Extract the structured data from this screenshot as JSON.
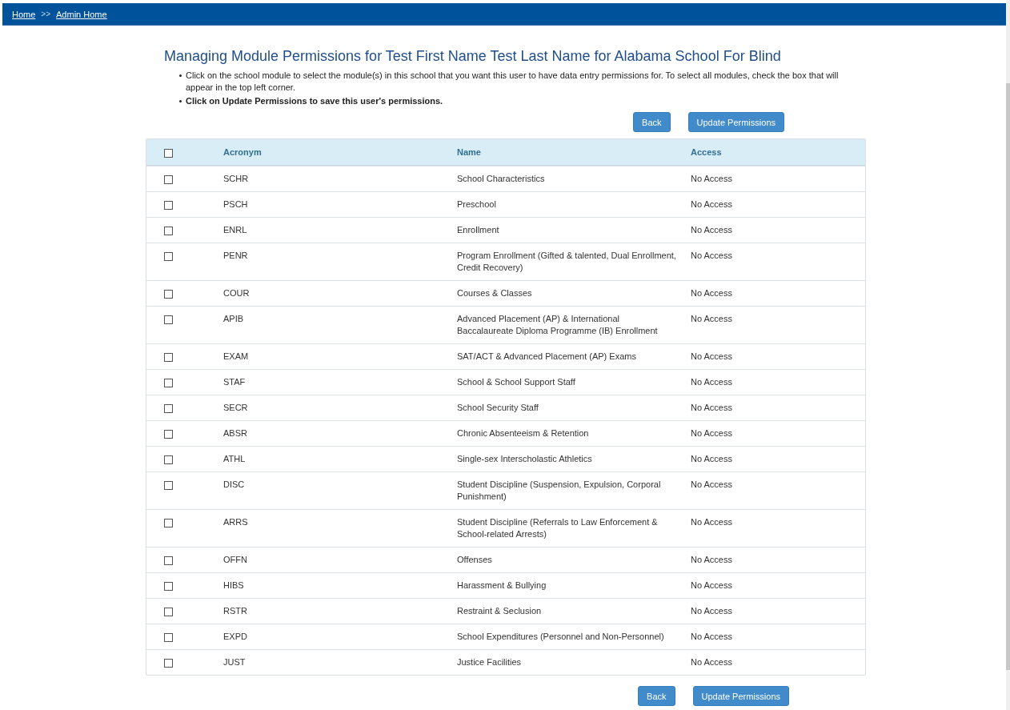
{
  "breadcrumbs": [
    {
      "label": "Home"
    },
    {
      "label": "Admin Home"
    }
  ],
  "breadcrumb_separator": ">>",
  "title": "Managing Module Permissions for Test First Name Test Last Name for Alabama School For Blind",
  "instructions": [
    {
      "text": "Click on the school module to select the module(s) in this school that you want this user to have data entry permissions for. To select all modules, check the box that will appear in the top left corner.",
      "bold": false
    },
    {
      "text": "Click on Update Permissions to save this user's permissions.",
      "bold": true
    }
  ],
  "top_buttons": [
    "Back",
    "Update Permissions"
  ],
  "table": {
    "select_all_checked": false,
    "columns": [
      "Acronym",
      "Name",
      "Access"
    ],
    "rows": [
      {
        "acronym": "SCHR",
        "name": "School Characteristics",
        "access": "No Access",
        "checked": false
      },
      {
        "acronym": "PSCH",
        "name": "Preschool",
        "access": "No Access",
        "checked": false
      },
      {
        "acronym": "ENRL",
        "name": "Enrollment",
        "access": "No Access",
        "checked": false
      },
      {
        "acronym": "PENR",
        "name": "Program Enrollment (Gifted & talented, Dual Enrollment, Credit Recovery)",
        "access": "No Access",
        "checked": false
      },
      {
        "acronym": "COUR",
        "name": "Courses & Classes",
        "access": "No Access",
        "checked": false
      },
      {
        "acronym": "APIB",
        "name": "Advanced Placement (AP) & International Baccalaureate Diploma Programme (IB) Enrollment",
        "access": "No Access",
        "checked": false
      },
      {
        "acronym": "EXAM",
        "name": "SAT/ACT & Advanced Placement (AP) Exams",
        "access": "No Access",
        "checked": false
      },
      {
        "acronym": "STAF",
        "name": "School & School Support Staff",
        "access": "No Access",
        "checked": false
      },
      {
        "acronym": "SECR",
        "name": "School Security Staff",
        "access": "No Access",
        "checked": false
      },
      {
        "acronym": "ABSR",
        "name": "Chronic Absenteeism & Retention",
        "access": "No Access",
        "checked": false
      },
      {
        "acronym": "ATHL",
        "name": "Single-sex Interscholastic Athletics",
        "access": "No Access",
        "checked": false
      },
      {
        "acronym": "DISC",
        "name": "Student Discipline (Suspension, Expulsion, Corporal Punishment)",
        "access": "No Access",
        "checked": false
      },
      {
        "acronym": "ARRS",
        "name": "Student Discipline (Referrals to Law Enforcement & School-related Arrests)",
        "access": "No Access",
        "checked": false
      },
      {
        "acronym": "OFFN",
        "name": "Offenses",
        "access": "No Access",
        "checked": false
      },
      {
        "acronym": "HIBS",
        "name": "Harassment & Bullying",
        "access": "No Access",
        "checked": false
      },
      {
        "acronym": "RSTR",
        "name": "Restraint & Seclusion",
        "access": "No Access",
        "checked": false
      },
      {
        "acronym": "EXPD",
        "name": "School Expenditures (Personnel and Non-Personnel)",
        "access": "No Access",
        "checked": false
      },
      {
        "acronym": "JUST",
        "name": "Justice Facilities",
        "access": "No Access",
        "checked": false
      }
    ]
  },
  "bottom_buttons": [
    "Back",
    "Update Permissions"
  ]
}
